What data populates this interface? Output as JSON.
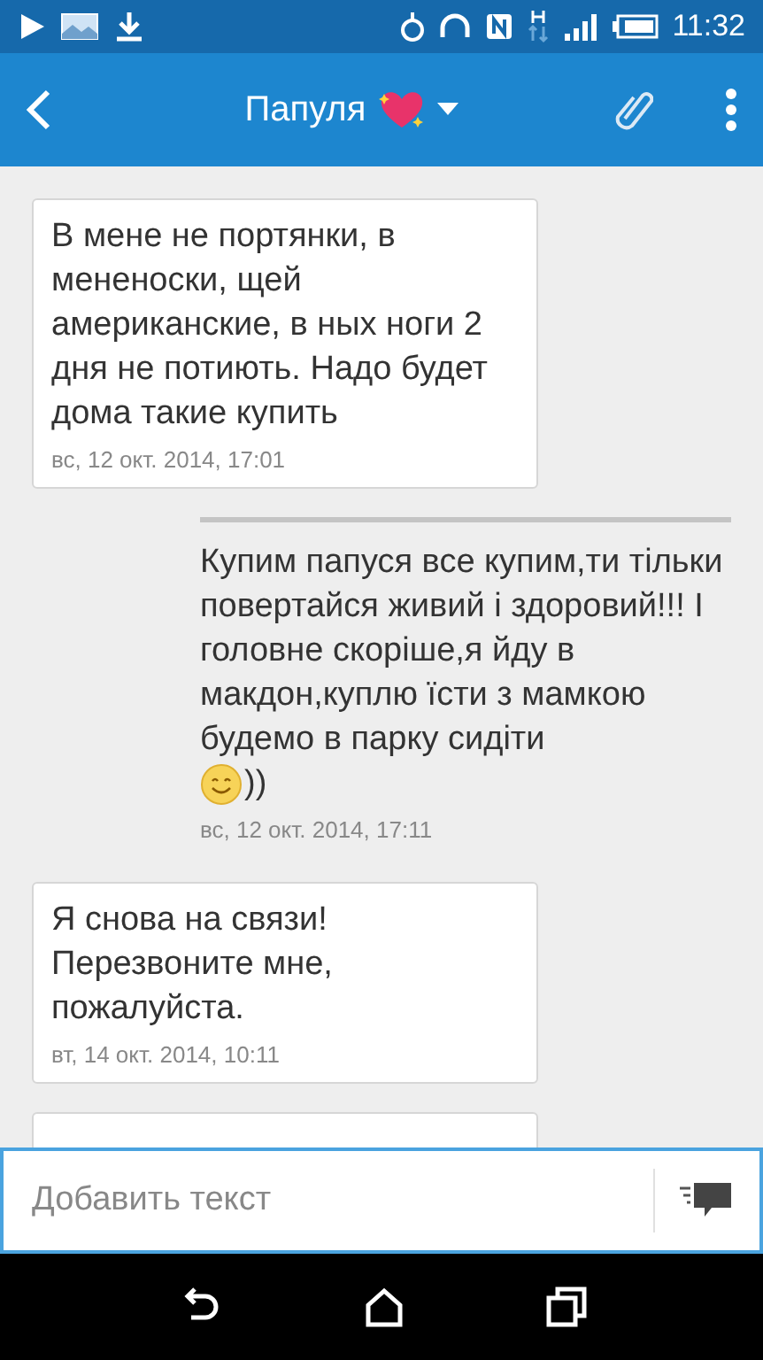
{
  "status_bar": {
    "time": "11:32"
  },
  "header": {
    "title": "Папуля"
  },
  "messages": [
    {
      "kind": "incoming",
      "text": "В мене не портянки, в мененоски, щей американские, в ных ноги 2 дня не потиють. Надо будет дома такие купить",
      "time": "вс, 12 окт. 2014, 17:01"
    },
    {
      "kind": "outgoing",
      "text": "Купим папуся все купим,ти тільки повертайся живий і здоровий!!! І головне скоріше,я йду в макдон,куплю їсти з мамкою будемо в парку сидіти",
      "emoji_tail": "))",
      "time": "вс, 12 окт. 2014, 17:11"
    },
    {
      "kind": "incoming",
      "text": "Я снова на связи! Перезвоните мне, пожалуйста.",
      "time": "вт, 14 окт. 2014, 10:11"
    },
    {
      "kind": "incoming"
    }
  ],
  "composer": {
    "placeholder": "Добавить текст"
  }
}
